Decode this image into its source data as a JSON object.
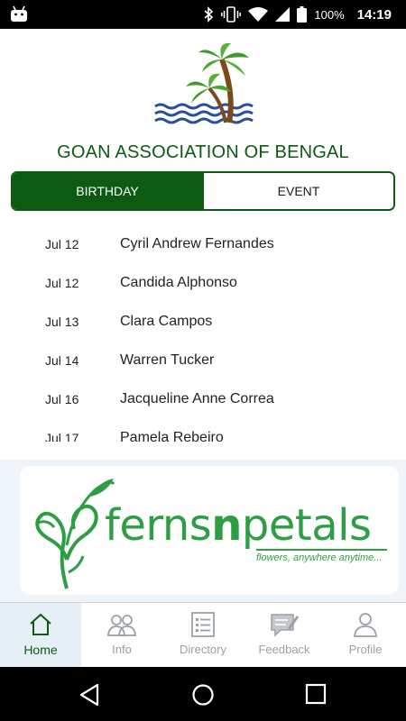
{
  "status_bar": {
    "battery": "100%",
    "time": "14:19"
  },
  "header": {
    "title": "GOAN ASSOCIATION OF BENGAL"
  },
  "tabs": [
    {
      "label": "BIRTHDAY",
      "active": true
    },
    {
      "label": "EVENT",
      "active": false
    }
  ],
  "birthdays": [
    {
      "date": "Jul 12",
      "name": "Cyril Andrew Fernandes"
    },
    {
      "date": "Jul 12",
      "name": "Candida Alphonso"
    },
    {
      "date": "Jul 13",
      "name": "Clara Campos"
    },
    {
      "date": "Jul 14",
      "name": "Warren Tucker"
    },
    {
      "date": "Jul 16",
      "name": "Jacqueline Anne Correa"
    },
    {
      "date": "Jul 17",
      "name": "Pamela Rebeiro"
    }
  ],
  "banner": {
    "brand_part1": "ferns",
    "brand_part2": "n",
    "brand_part3": "petals",
    "tagline": "flowers, anywhere anytime..."
  },
  "bottom_nav": [
    {
      "label": "Home",
      "icon": "home-icon",
      "active": true
    },
    {
      "label": "Info",
      "icon": "people-icon",
      "active": false
    },
    {
      "label": "Directory",
      "icon": "list-icon",
      "active": false
    },
    {
      "label": "Feedback",
      "icon": "feedback-icon",
      "active": false
    },
    {
      "label": "Profile",
      "icon": "person-icon",
      "active": false
    }
  ],
  "colors": {
    "primary": "#0d5a12",
    "brand_green": "#2e9e45",
    "inactive_nav": "#9aa0a6"
  }
}
